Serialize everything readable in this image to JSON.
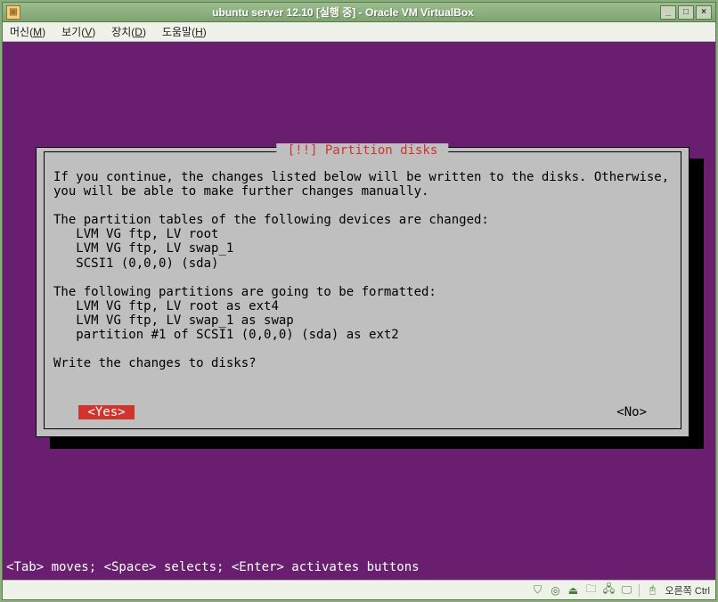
{
  "window": {
    "title": "ubuntu server 12.10 [실행 중] - Oracle VM VirtualBox",
    "controls": {
      "min": "_",
      "max": "□",
      "close": "×"
    }
  },
  "menu": {
    "machine": {
      "label": "머신",
      "accel": "M"
    },
    "view": {
      "label": "보기",
      "accel": "V"
    },
    "devices": {
      "label": "장치",
      "accel": "D"
    },
    "help": {
      "label": "도움말",
      "accel": "H"
    }
  },
  "dialog": {
    "title": " [!!] Partition disks ",
    "intro": "If you continue, the changes listed below will be written to the disks. Otherwise, you will be able to make further changes manually.",
    "tables_header": "The partition tables of the following devices are changed:",
    "tables": [
      "LVM VG ftp, LV root",
      "LVM VG ftp, LV swap_1",
      "SCSI1 (0,0,0) (sda)"
    ],
    "format_header": "The following partitions are going to be formatted:",
    "formats": [
      "LVM VG ftp, LV root as ext4",
      "LVM VG ftp, LV swap_1 as swap",
      "partition #1 of SCSI1 (0,0,0) (sda) as ext2"
    ],
    "question": "Write the changes to disks?",
    "yes": "<Yes>",
    "no": "<No>"
  },
  "hint": "<Tab> moves; <Space> selects; <Enter> activates buttons",
  "status": {
    "host_key": "오른쪽 Ctrl",
    "icons": {
      "hdd": "⛉",
      "cd": "◎",
      "usb": "⏏",
      "folder": "🗀",
      "net": "🖧",
      "display": "🖵",
      "mouse": "🖰"
    }
  }
}
